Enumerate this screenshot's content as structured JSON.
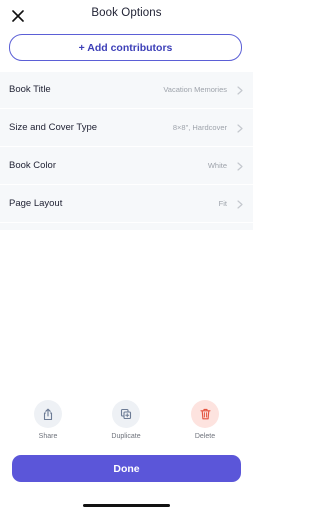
{
  "header": {
    "title": "Book Options",
    "close_icon": "close-icon"
  },
  "add_contributors": {
    "label": "+ Add contributors"
  },
  "options": [
    {
      "label": "Book Title",
      "value": "Vacation Memories"
    },
    {
      "label": "Size and Cover Type",
      "value": "8×8\", Hardcover"
    },
    {
      "label": "Book Color",
      "value": "White"
    },
    {
      "label": "Page Layout",
      "value": "Fit"
    }
  ],
  "actions": {
    "share": {
      "label": "Share",
      "icon": "share-icon"
    },
    "duplicate": {
      "label": "Duplicate",
      "icon": "duplicate-icon"
    },
    "delete": {
      "label": "Delete",
      "icon": "trash-icon"
    }
  },
  "done": {
    "label": "Done"
  },
  "colors": {
    "accent": "#5b56d9",
    "delete_bg": "#fde3df",
    "delete_icon": "#e4533f",
    "action_bg": "#eef1f5",
    "action_icon": "#6c7b95"
  }
}
